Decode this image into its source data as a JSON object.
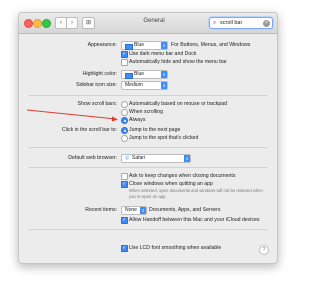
{
  "window": {
    "title": "General"
  },
  "search": {
    "value": "scroll bar"
  },
  "appearance": {
    "label": "Appearance:",
    "value": "Blue",
    "description": "For Buttons, Menus, and Windows"
  },
  "dark_menu": {
    "label": "Use dark menu bar and Dock",
    "checked": true
  },
  "auto_hide": {
    "label": "Automatically hide and show the menu bar",
    "checked": false
  },
  "highlight": {
    "label": "Highlight color:",
    "value": "Blue"
  },
  "sidebar_icon": {
    "label": "Sidebar icon size:",
    "value": "Medium"
  },
  "scroll_bars": {
    "label": "Show scroll bars:",
    "options": [
      "Automatically based on mouse or trackpad",
      "When scrolling",
      "Always"
    ],
    "selected": "Always"
  },
  "click_scroll": {
    "label": "Click in the scroll bar to:",
    "options": [
      "Jump to the next page",
      "Jump to the spot that's clicked"
    ],
    "selected": "Jump to the next page"
  },
  "browser": {
    "label": "Default web browser:",
    "value": "Safari"
  },
  "ask_changes": {
    "label": "Ask to keep changes when closing documents",
    "checked": false
  },
  "close_windows": {
    "label": "Close windows when quitting an app",
    "checked": true,
    "note": "When selected, open documents and windows will not be restored when you re-open an app."
  },
  "recent_items": {
    "label": "Recent items:",
    "value": "None",
    "suffix": "Documents, Apps, and Servers"
  },
  "handoff": {
    "label": "Allow Handoff between this Mac and your iCloud devices",
    "checked": true
  },
  "lcd_font": {
    "label": "Use LCD font smoothing when available",
    "checked": true
  },
  "colors": {
    "accent": "#3f8ef7",
    "annotation_arrow": "#e23b2e"
  }
}
